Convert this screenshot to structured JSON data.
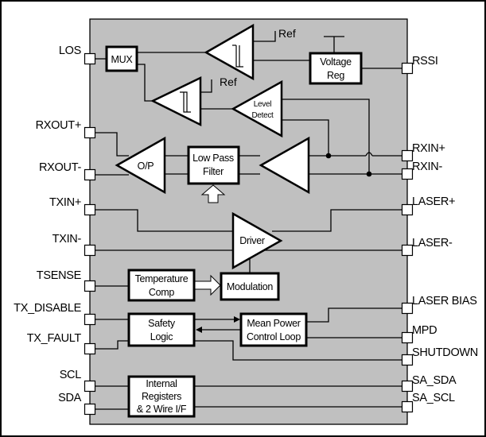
{
  "diagram": {
    "type": "block-diagram",
    "body_color": "#c0c0c0",
    "left_pins": [
      {
        "id": "los",
        "label": "LOS"
      },
      {
        "id": "rxout-plus",
        "label": "RXOUT+"
      },
      {
        "id": "rxout-minus",
        "label": "RXOUT-"
      },
      {
        "id": "txin-plus",
        "label": "TXIN+"
      },
      {
        "id": "txin-minus",
        "label": "TXIN-"
      },
      {
        "id": "tsense",
        "label": "TSENSE"
      },
      {
        "id": "tx-disable",
        "label": "TX_DISABLE"
      },
      {
        "id": "tx-fault",
        "label": "TX_FAULT"
      },
      {
        "id": "scl",
        "label": "SCL"
      },
      {
        "id": "sda",
        "label": "SDA"
      }
    ],
    "right_pins": [
      {
        "id": "rssi",
        "label": "RSSI"
      },
      {
        "id": "rxin-plus",
        "label": "RXIN+"
      },
      {
        "id": "rxin-minus",
        "label": "RXIN-"
      },
      {
        "id": "laser-plus",
        "label": "LASER+"
      },
      {
        "id": "laser-minus",
        "label": "LASER-"
      },
      {
        "id": "laser-bias",
        "label": "LASER BIAS"
      },
      {
        "id": "mpd",
        "label": "MPD"
      },
      {
        "id": "shutdown",
        "label": "SHUTDOWN"
      },
      {
        "id": "sa-sda",
        "label": "SA_SDA"
      },
      {
        "id": "sa-scl",
        "label": "SA_SCL"
      }
    ],
    "blocks": {
      "mux": "MUX",
      "voltage_reg": [
        "Voltage",
        "Reg"
      ],
      "level_detect": [
        "Level",
        "Detect"
      ],
      "op": "O/P",
      "low_pass_filter": [
        "Low Pass",
        "Filter"
      ],
      "driver": "Driver",
      "temperature_comp": [
        "Temperature",
        "Comp"
      ],
      "modulation": "Modulation",
      "safety_logic": [
        "Safety",
        "Logic"
      ],
      "mean_power_control_loop": [
        "Mean Power",
        "Control Loop"
      ],
      "internal_registers": [
        "Internal",
        "Registers",
        "& 2 Wire I/F"
      ]
    },
    "ref_labels": [
      "Ref",
      "Ref"
    ]
  }
}
